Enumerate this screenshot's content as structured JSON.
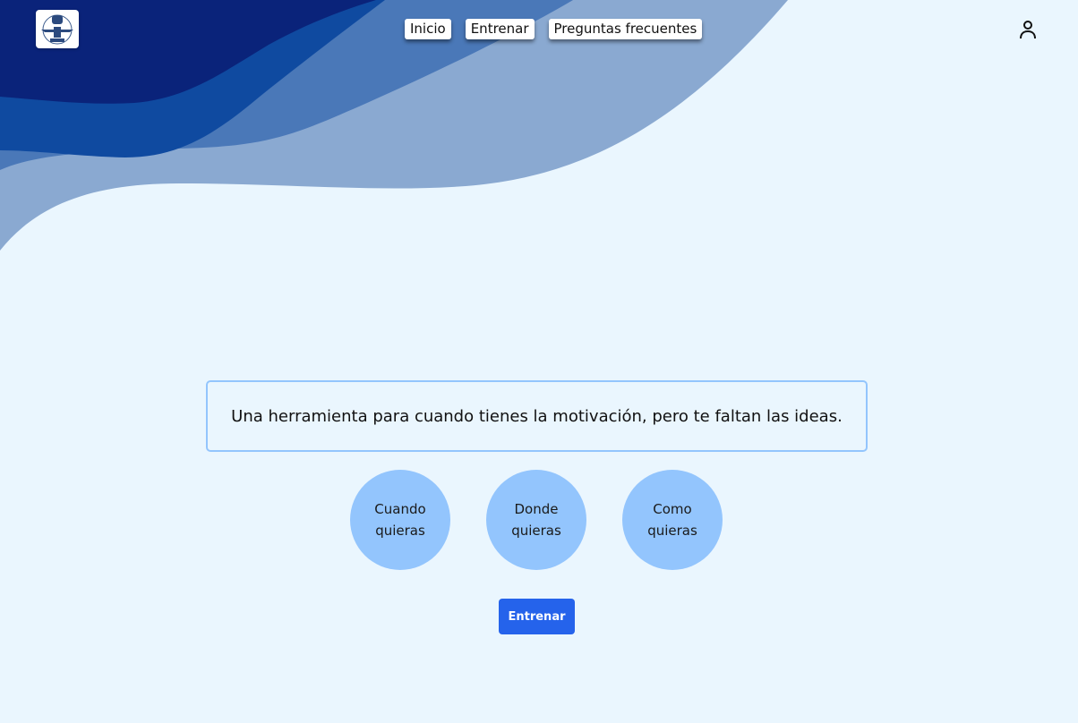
{
  "nav": {
    "items": [
      {
        "label": "Inicio"
      },
      {
        "label": "Entrenar"
      },
      {
        "label": "Preguntas frecuentes"
      }
    ]
  },
  "logo": {
    "icon": "plane-emblem-icon"
  },
  "header": {
    "user_icon": "user-icon"
  },
  "hero": {
    "tagline": "Una herramienta para cuando tienes la motivación, pero te faltan las ideas."
  },
  "features": [
    {
      "label": "Cuando quieras"
    },
    {
      "label": "Donde quieras"
    },
    {
      "label": "Como quieras"
    }
  ],
  "cta": {
    "label": "Entrenar"
  },
  "colors": {
    "background": "#eaf6fe",
    "wave_dark": "#0a237a",
    "wave_mid": "#0f4aa0",
    "wave_light": "#4a78b8",
    "wave_pale": "#8aa9d1",
    "circle": "#93c5fd",
    "accent": "#2563eb"
  }
}
